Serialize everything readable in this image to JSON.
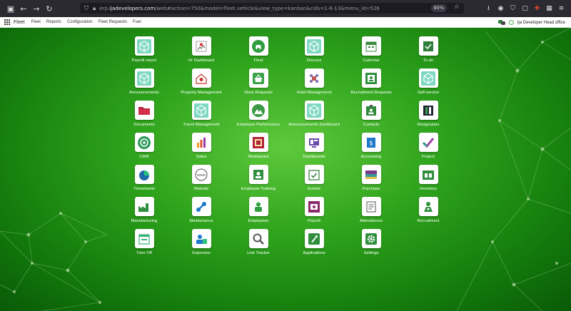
{
  "browser": {
    "url_prefix": "erp.",
    "url_host": "ijadevelopers.com",
    "url_path": "/web#action=750&model=fleet.vehicle&view_type=kanban&cids=1-8-13&menu_id=526",
    "zoom": "90%"
  },
  "topbar": {
    "app_name": "Fleet",
    "menu": [
      "Fleet",
      "Reports",
      "Configuration",
      "Fleet Requests",
      "Fuel"
    ],
    "company": "Ija Developer Head office"
  },
  "apps": [
    {
      "label": "Payroll report",
      "icon": "cube-icon"
    },
    {
      "label": "Hr Dashboard",
      "icon": "hr-dashboard-icon"
    },
    {
      "label": "Fleet",
      "icon": "fleet-icon"
    },
    {
      "label": "Discuss",
      "icon": "cube-icon"
    },
    {
      "label": "Calendar",
      "icon": "calendar-icon"
    },
    {
      "label": "To-do",
      "icon": "todo-icon"
    },
    {
      "label": "Announcements",
      "icon": "cube-icon"
    },
    {
      "label": "Property Management",
      "icon": "property-icon"
    },
    {
      "label": "Store Requests",
      "icon": "store-icon"
    },
    {
      "label": "Hotel Management",
      "icon": "hotel-icon"
    },
    {
      "label": "Recruitment Requests",
      "icon": "recruitment-request-icon"
    },
    {
      "label": "Self-service",
      "icon": "cube-icon"
    },
    {
      "label": "Documents",
      "icon": "folder-icon"
    },
    {
      "label": "Travel Management",
      "icon": "cube-icon"
    },
    {
      "label": "Employee Performance",
      "icon": "performance-icon"
    },
    {
      "label": "Announcements Dashboard",
      "icon": "cube-icon"
    },
    {
      "label": "Contacts",
      "icon": "contacts-icon"
    },
    {
      "label": "Resignation",
      "icon": "resignation-icon"
    },
    {
      "label": "CRM",
      "icon": "crm-icon"
    },
    {
      "label": "Sales",
      "icon": "sales-icon"
    },
    {
      "label": "Restaurant",
      "icon": "restaurant-icon"
    },
    {
      "label": "Dashboards",
      "icon": "dashboards-icon"
    },
    {
      "label": "Accounting",
      "icon": "accounting-icon"
    },
    {
      "label": "Project",
      "icon": "project-icon"
    },
    {
      "label": "Timesheets",
      "icon": "timesheets-icon"
    },
    {
      "label": "Website",
      "icon": "website-icon"
    },
    {
      "label": "Employee Training",
      "icon": "training-icon"
    },
    {
      "label": "Events",
      "icon": "events-icon"
    },
    {
      "label": "Purchase",
      "icon": "purchase-icon"
    },
    {
      "label": "Inventory",
      "icon": "inventory-icon"
    },
    {
      "label": "Manufacturing",
      "icon": "manufacturing-icon"
    },
    {
      "label": "Maintenance",
      "icon": "maintenance-icon"
    },
    {
      "label": "Employees",
      "icon": "employees-icon"
    },
    {
      "label": "Payroll",
      "icon": "payroll-icon"
    },
    {
      "label": "Attendances",
      "icon": "attendances-icon"
    },
    {
      "label": "Recruitment",
      "icon": "recruitment-icon"
    },
    {
      "label": "Time Off",
      "icon": "time-off-icon"
    },
    {
      "label": "Expenses",
      "icon": "expenses-icon"
    },
    {
      "label": "Link Tracker",
      "icon": "link-tracker-icon"
    },
    {
      "label": "Applications",
      "icon": "applications-icon"
    },
    {
      "label": "Settings",
      "icon": "settings-icon"
    }
  ]
}
